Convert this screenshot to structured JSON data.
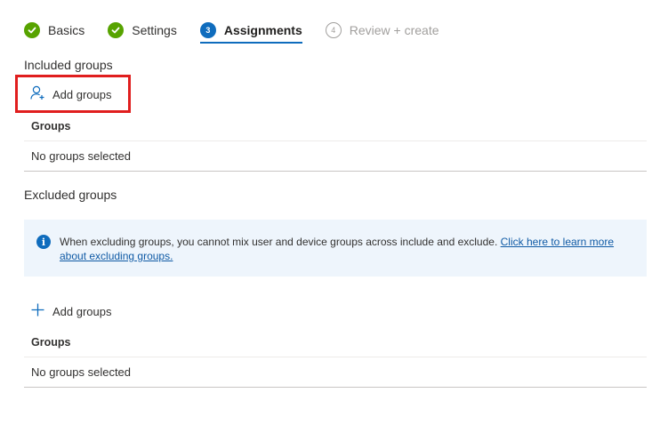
{
  "steps": [
    {
      "label": "Basics",
      "state": "done"
    },
    {
      "label": "Settings",
      "state": "done"
    },
    {
      "label": "Assignments",
      "state": "current",
      "number": "3"
    },
    {
      "label": "Review + create",
      "state": "pending",
      "number": "4"
    }
  ],
  "included": {
    "title": "Included groups",
    "add_label": "Add groups",
    "column_header": "Groups",
    "empty_text": "No groups selected"
  },
  "excluded": {
    "title": "Excluded groups",
    "info_text": "When excluding groups, you cannot mix user and device groups across include and exclude.",
    "info_link": "Click here to learn more about excluding groups.",
    "add_label": "Add groups",
    "column_header": "Groups",
    "empty_text": "No groups selected"
  },
  "colors": {
    "done": "#57a300",
    "accent": "#0f6cbd",
    "highlight": "#e01e1e",
    "info_bg": "#eef5fc"
  }
}
